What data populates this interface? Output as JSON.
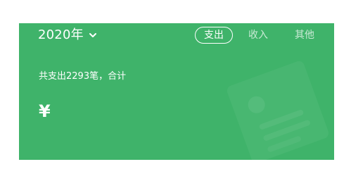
{
  "header": {
    "year_label": "2020年",
    "tabs": [
      {
        "label": "支出",
        "active": true
      },
      {
        "label": "收入",
        "active": false
      },
      {
        "label": "其他",
        "active": false
      }
    ],
    "summary_text": "共支出2293笔，合计",
    "currency_symbol": "¥"
  },
  "icons": {
    "dropdown": "chevron-down-icon",
    "decoration": "receipt-illustration-icon"
  },
  "colors": {
    "header_background": "#3fb36a",
    "text": "#ffffff",
    "inactive_tab_text": "rgba(255,255,255,0.72)"
  }
}
